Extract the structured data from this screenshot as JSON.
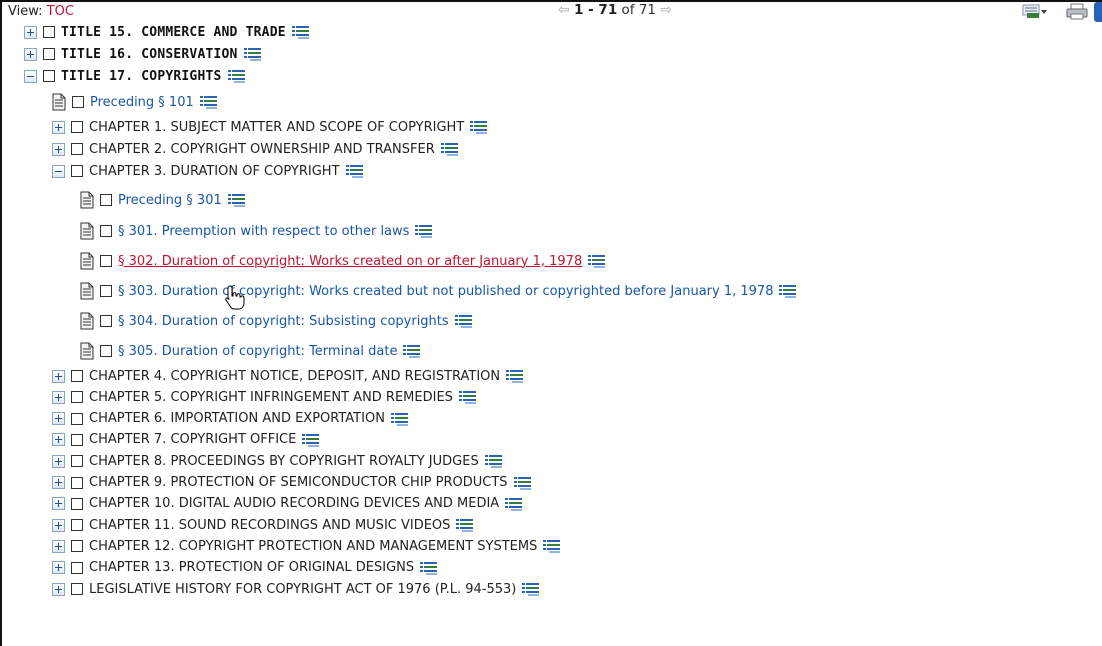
{
  "header": {
    "view_label": "View:",
    "view_value": "TOC",
    "pager_range": "1 - 71",
    "pager_of": "of 71",
    "prev_arrow": "⇦",
    "next_arrow": "⇨",
    "icons": [
      "fast-print-icon",
      "print-icon",
      "blue-tab-icon"
    ]
  },
  "tree": {
    "titles": [
      {
        "label": "TITLE 15. COMMERCE AND TRADE",
        "expanded": false
      },
      {
        "label": "TITLE 16. CONSERVATION",
        "expanded": false
      },
      {
        "label": "TITLE 17. COPYRIGHTS",
        "expanded": true
      }
    ],
    "title17_preceding": "Preceding § 101",
    "chapters_top": [
      {
        "label": "CHAPTER 1. SUBJECT MATTER AND SCOPE OF COPYRIGHT",
        "expanded": false
      },
      {
        "label": "CHAPTER 2. COPYRIGHT OWNERSHIP AND TRANSFER",
        "expanded": false
      },
      {
        "label": "CHAPTER 3. DURATION OF COPYRIGHT",
        "expanded": true
      }
    ],
    "chapter3_sections": [
      {
        "label": "Preceding § 301",
        "active": false
      },
      {
        "label": "§ 301. Preemption with respect to other laws",
        "active": false
      },
      {
        "label": "§ 302. Duration of copyright: Works created on or after January 1, 1978",
        "active": true
      },
      {
        "label": "§ 303. Duration of copyright: Works created but not published or copyrighted before January 1, 1978",
        "active": false
      },
      {
        "label": "§ 304. Duration of copyright: Subsisting copyrights",
        "active": false
      },
      {
        "label": "§ 305. Duration of copyright: Terminal date",
        "active": false
      }
    ],
    "chapters_bottom": [
      {
        "label": "CHAPTER 4. COPYRIGHT NOTICE, DEPOSIT, AND REGISTRATION",
        "expanded": false
      },
      {
        "label": "CHAPTER 5. COPYRIGHT INFRINGEMENT AND REMEDIES",
        "expanded": false
      },
      {
        "label": "CHAPTER 6. IMPORTATION AND EXPORTATION",
        "expanded": false
      },
      {
        "label": "CHAPTER 7. COPYRIGHT OFFICE",
        "expanded": false
      },
      {
        "label": "CHAPTER 8. PROCEEDINGS BY COPYRIGHT ROYALTY JUDGES",
        "expanded": false
      },
      {
        "label": "CHAPTER 9. PROTECTION OF SEMICONDUCTOR CHIP PRODUCTS",
        "expanded": false
      },
      {
        "label": "CHAPTER 10. DIGITAL AUDIO RECORDING DEVICES AND MEDIA",
        "expanded": false
      },
      {
        "label": "CHAPTER 11. SOUND RECORDINGS AND MUSIC VIDEOS",
        "expanded": false
      },
      {
        "label": "CHAPTER 12. COPYRIGHT PROTECTION AND MANAGEMENT SYSTEMS",
        "expanded": false
      },
      {
        "label": "CHAPTER 13. PROTECTION OF ORIGINAL DESIGNS",
        "expanded": false
      },
      {
        "label": "LEGISLATIVE HISTORY FOR COPYRIGHT ACT OF 1976 (P.L. 94-553)",
        "expanded": false
      }
    ]
  },
  "colors": {
    "link": "#1a56a8",
    "active_link": "#c4122f",
    "view_value": "#c4122f"
  }
}
